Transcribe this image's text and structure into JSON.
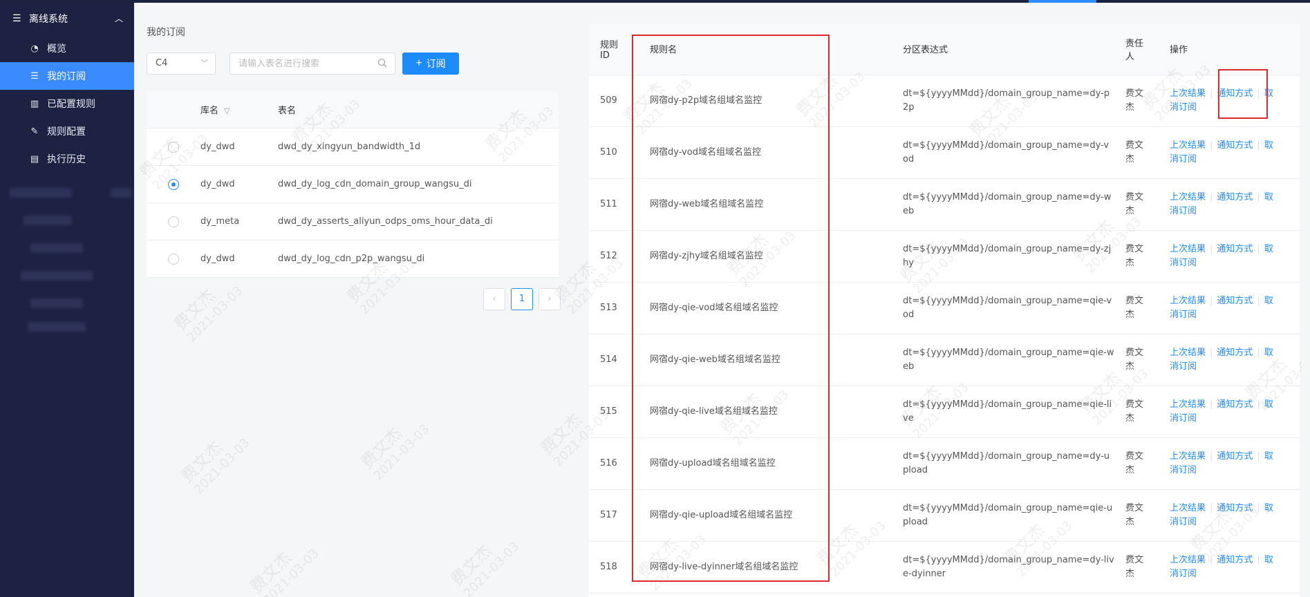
{
  "sidebar": {
    "system_title": "离线系统",
    "items": [
      {
        "label": "概览",
        "icon": "dashboard-icon"
      },
      {
        "label": "我的订阅",
        "icon": "list-icon",
        "active": true
      },
      {
        "label": "已配置规则",
        "icon": "bar-chart-icon"
      },
      {
        "label": "规则配置",
        "icon": "edit-icon"
      },
      {
        "label": "执行历史",
        "icon": "history-icon"
      }
    ]
  },
  "subscription": {
    "title": "我的订阅",
    "cluster_value": "C4",
    "search_placeholder": "请输入表名进行搜索",
    "subscribe_label": "订阅",
    "headers": {
      "db": "库名",
      "table": "表名"
    },
    "rows": [
      {
        "db": "dy_dwd",
        "table": "dwd_dy_xingyun_bandwidth_1d",
        "selected": false
      },
      {
        "db": "dy_dwd",
        "table": "dwd_dy_log_cdn_domain_group_wangsu_di",
        "selected": true
      },
      {
        "db": "dy_meta",
        "table": "dwd_dy_asserts_aliyun_odps_oms_hour_data_di",
        "selected": false
      },
      {
        "db": "dy_dwd",
        "table": "dwd_dy_log_cdn_p2p_wangsu_di",
        "selected": false
      }
    ],
    "page": "1"
  },
  "rules": {
    "headers": {
      "id": "规则ID",
      "name": "规则名",
      "expr": "分区表达式",
      "owner": "责任人",
      "ops": "操作"
    },
    "rows": [
      {
        "id": "509",
        "name": "网宿dy-p2p域名组域名监控",
        "expr": "dt=${yyyyMMdd}/domain_group_name=dy-p2p",
        "owner": "费文杰"
      },
      {
        "id": "510",
        "name": "网宿dy-vod域名组域名监控",
        "expr": "dt=${yyyyMMdd}/domain_group_name=dy-vod",
        "owner": "费文杰"
      },
      {
        "id": "511",
        "name": "网宿dy-web域名组域名监控",
        "expr": "dt=${yyyyMMdd}/domain_group_name=dy-web",
        "owner": "费文杰"
      },
      {
        "id": "512",
        "name": "网宿dy-zjhy域名组域名监控",
        "expr": "dt=${yyyyMMdd}/domain_group_name=dy-zjhy",
        "owner": "费文杰"
      },
      {
        "id": "513",
        "name": "网宿dy-qie-vod域名组域名监控",
        "expr": "dt=${yyyyMMdd}/domain_group_name=qie-vod",
        "owner": "费文杰"
      },
      {
        "id": "514",
        "name": "网宿dy-qie-web域名组域名监控",
        "expr": "dt=${yyyyMMdd}/domain_group_name=qie-web",
        "owner": "费文杰"
      },
      {
        "id": "515",
        "name": "网宿dy-qie-live域名组域名监控",
        "expr": "dt=${yyyyMMdd}/domain_group_name=qie-live",
        "owner": "费文杰"
      },
      {
        "id": "516",
        "name": "网宿dy-upload域名组域名监控",
        "expr": "dt=${yyyyMMdd}/domain_group_name=dy-upload",
        "owner": "费文杰"
      },
      {
        "id": "517",
        "name": "网宿dy-qie-upload域名组域名监控",
        "expr": "dt=${yyyyMMdd}/domain_group_name=qie-upload",
        "owner": "费文杰"
      },
      {
        "id": "518",
        "name": "网宿dy-live-dyinner域名组域名监控",
        "expr": "dt=${yyyyMMdd}/domain_group_name=dy-live-dyinner",
        "owner": "费文杰"
      }
    ],
    "ops": {
      "last_result": "上次结果",
      "notify": "通知方式",
      "cancel": "取",
      "unsubscribe": "消订阅"
    }
  },
  "watermark": {
    "name": "费文杰",
    "date": "2021-03-03"
  },
  "colors": {
    "sidebar_bg": "#1d2242",
    "accent": "#1d8cf8",
    "highlight_box": "#e02828"
  }
}
